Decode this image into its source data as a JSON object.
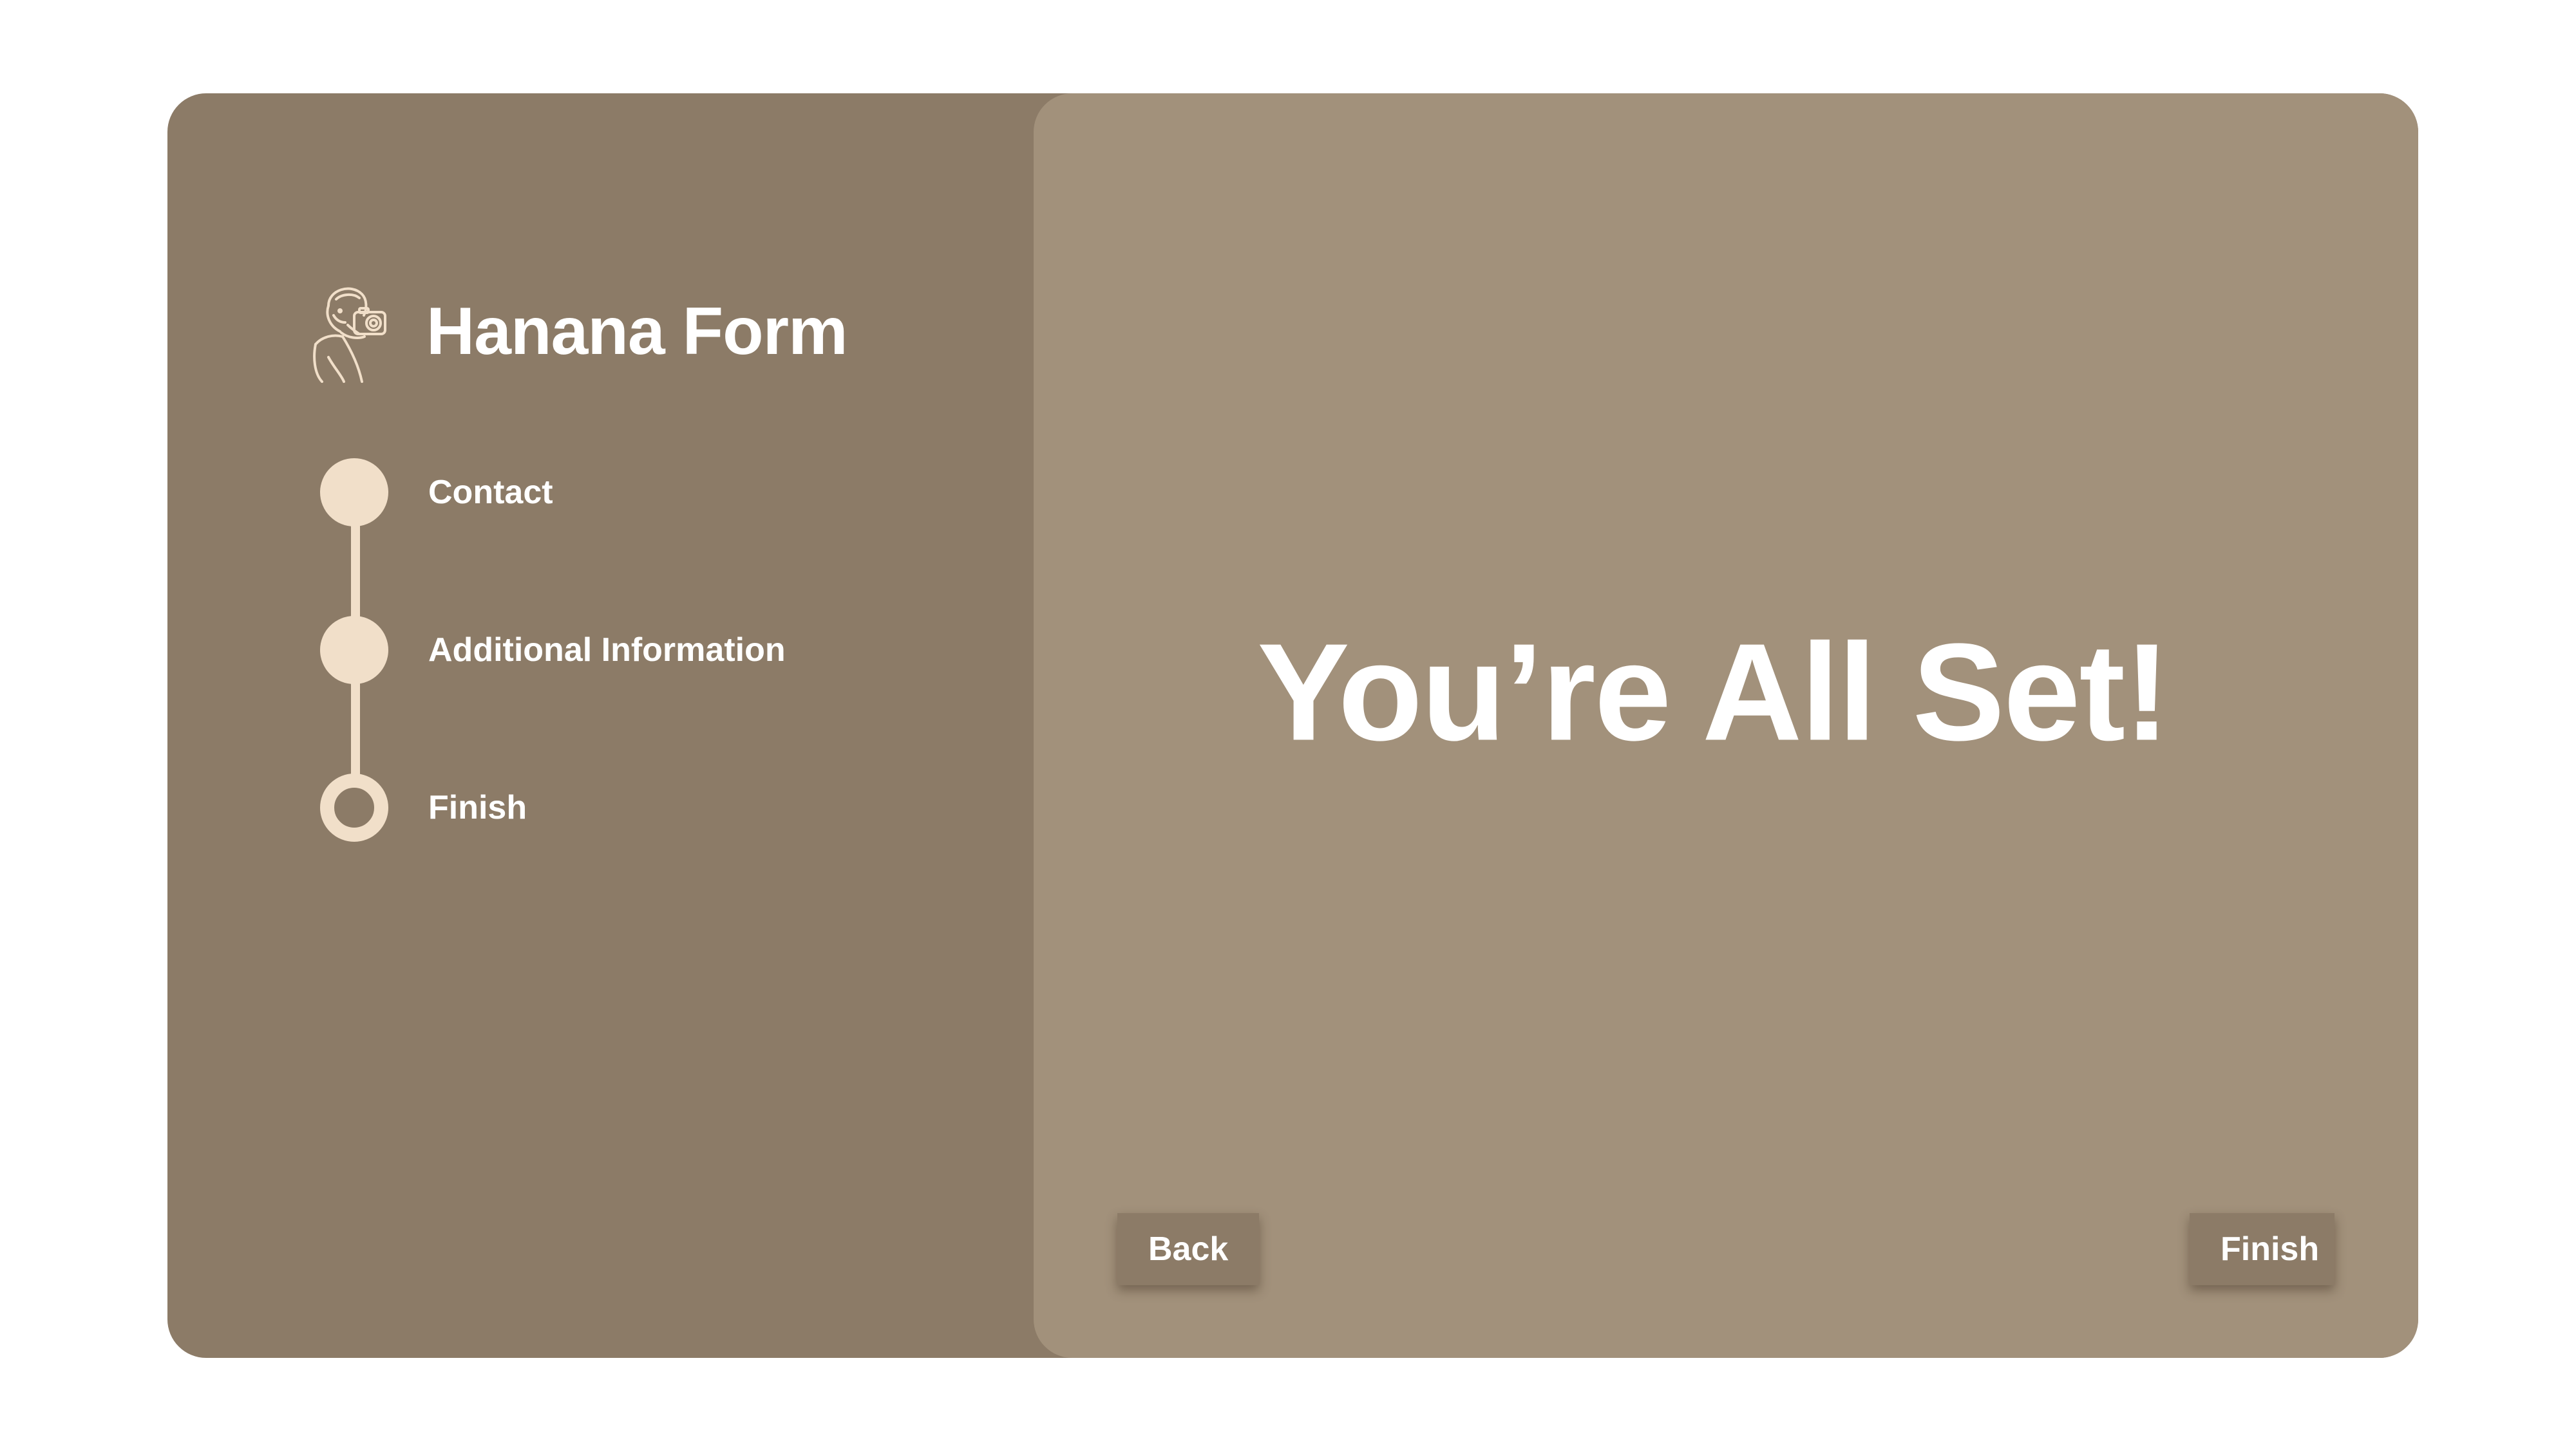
{
  "brand": {
    "title": "Hanana Form",
    "logo_icon": "photographer-icon"
  },
  "steps": [
    {
      "label": "Contact",
      "status": "completed"
    },
    {
      "label": "Additional Information",
      "status": "completed"
    },
    {
      "label": "Finish",
      "status": "current"
    }
  ],
  "main": {
    "headline": "You’re All Set!"
  },
  "buttons": {
    "back_label": "Back",
    "finish_label": "Finish"
  },
  "colors": {
    "sidebar_bg": "#8c7b67",
    "main_bg": "#a2917b",
    "accent": "#f1dfc9",
    "text": "#ffffff"
  }
}
